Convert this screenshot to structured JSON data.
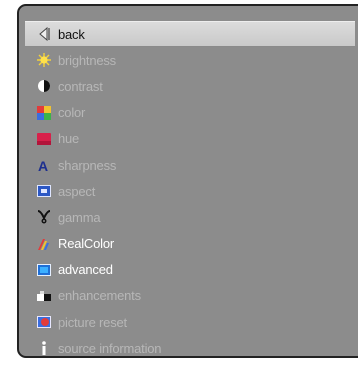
{
  "menu": {
    "items": [
      {
        "label": "back",
        "icon": "back-arrow-icon",
        "state": "selected"
      },
      {
        "label": "brightness",
        "icon": "sun-icon",
        "state": "dim"
      },
      {
        "label": "contrast",
        "icon": "contrast-icon",
        "state": "dim"
      },
      {
        "label": "color",
        "icon": "color-icon",
        "state": "dim"
      },
      {
        "label": "hue",
        "icon": "hue-icon",
        "state": "dim"
      },
      {
        "label": "sharpness",
        "icon": "sharpness-icon",
        "state": "dim"
      },
      {
        "label": "aspect",
        "icon": "aspect-icon",
        "state": "dim"
      },
      {
        "label": "gamma",
        "icon": "gamma-icon",
        "state": "dim"
      },
      {
        "label": "RealColor",
        "icon": "realcolor-icon",
        "state": "bright"
      },
      {
        "label": "advanced",
        "icon": "advanced-icon",
        "state": "bright"
      },
      {
        "label": "enhancements",
        "icon": "enhancements-icon",
        "state": "dim"
      },
      {
        "label": "picture reset",
        "icon": "picture-reset-icon",
        "state": "dim"
      },
      {
        "label": "source information",
        "icon": "info-icon",
        "state": "dim"
      }
    ]
  },
  "colors": {
    "panel": "#8c8c8c",
    "selected_bg": "#d4d4d4",
    "dim_text": "#b7b7b7",
    "bright_text": "#ffffff"
  }
}
